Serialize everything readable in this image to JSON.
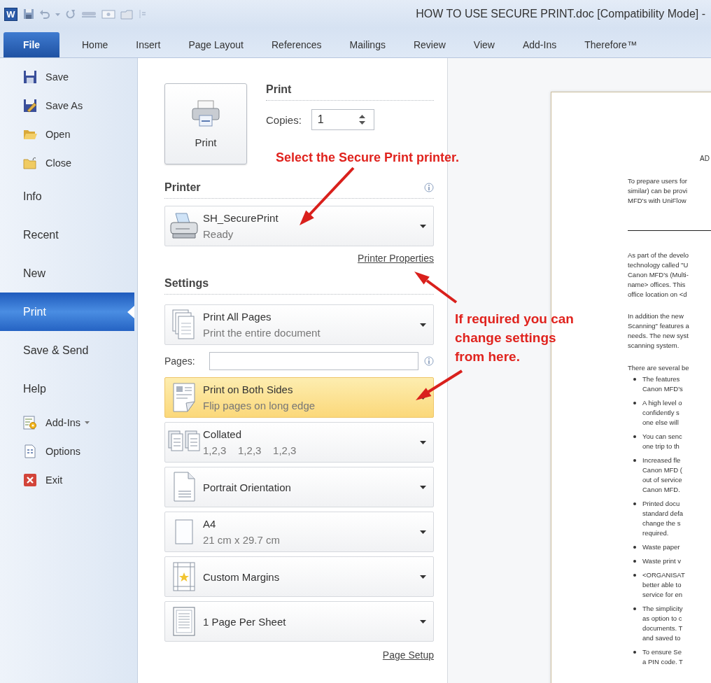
{
  "window": {
    "app_logo": "W",
    "title": "HOW TO USE SECURE PRINT.doc [Compatibility Mode] -"
  },
  "ribbon_tabs": [
    {
      "label": "File",
      "selected": true
    },
    {
      "label": "Home",
      "selected": false
    },
    {
      "label": "Insert",
      "selected": false
    },
    {
      "label": "Page Layout",
      "selected": false
    },
    {
      "label": "References",
      "selected": false
    },
    {
      "label": "Mailings",
      "selected": false
    },
    {
      "label": "Review",
      "selected": false
    },
    {
      "label": "View",
      "selected": false
    },
    {
      "label": "Add-Ins",
      "selected": false
    },
    {
      "label": "Therefore™",
      "selected": false
    }
  ],
  "sidebar": {
    "items": [
      {
        "label": "Save",
        "kind": "command",
        "selected": false,
        "has_menu": false
      },
      {
        "label": "Save As",
        "kind": "command",
        "selected": false,
        "has_menu": false
      },
      {
        "label": "Open",
        "kind": "command",
        "selected": false,
        "has_menu": false
      },
      {
        "label": "Close",
        "kind": "command",
        "selected": false,
        "has_menu": false
      },
      {
        "label": "Info",
        "kind": "view",
        "selected": false,
        "has_menu": false
      },
      {
        "label": "Recent",
        "kind": "view",
        "selected": false,
        "has_menu": false
      },
      {
        "label": "New",
        "kind": "view",
        "selected": false,
        "has_menu": false
      },
      {
        "label": "Print",
        "kind": "view",
        "selected": true,
        "has_menu": false
      },
      {
        "label": "Save & Send",
        "kind": "view",
        "selected": false,
        "has_menu": false
      },
      {
        "label": "Help",
        "kind": "view",
        "selected": false,
        "has_menu": false
      },
      {
        "label": "Add-Ins",
        "kind": "command",
        "selected": false,
        "has_menu": true
      },
      {
        "label": "Options",
        "kind": "command",
        "selected": false,
        "has_menu": false
      },
      {
        "label": "Exit",
        "kind": "command",
        "selected": false,
        "has_menu": false
      }
    ]
  },
  "print": {
    "heading": "Print",
    "button": "Print",
    "copies_label": "Copies:",
    "copies": "1"
  },
  "printer": {
    "heading": "Printer",
    "name": "SH_SecurePrint",
    "status": "Ready",
    "properties_link": "Printer Properties"
  },
  "settings": {
    "heading": "Settings",
    "pages_label": "Pages:",
    "page_setup_link": "Page Setup",
    "options": [
      {
        "title": "Print All Pages",
        "subtitle": "Print the entire document",
        "highlighted": false
      },
      {
        "title": "Print on Both Sides",
        "subtitle": "Flip pages on long edge",
        "highlighted": true
      },
      {
        "title": "Collated",
        "subtitle": "1,2,3    1,2,3    1,2,3",
        "highlighted": false
      },
      {
        "title": "Portrait Orientation",
        "highlighted": false
      },
      {
        "title": "A4",
        "subtitle": "21 cm x 29.7 cm",
        "highlighted": false
      },
      {
        "title": "Custom Margins",
        "highlighted": false
      },
      {
        "title": "1 Page Per Sheet",
        "highlighted": false
      }
    ]
  },
  "annotations": [
    {
      "lines": [
        "Select the Secure Print printer."
      ]
    },
    {
      "lines": [
        "If required you can",
        "change settings",
        "from here."
      ]
    }
  ],
  "document": {
    "heading": "AD",
    "blocks": [
      {
        "kind": "paragraph",
        "lines": [
          "To prepare users for",
          "similar) can be provi",
          "MFD's with UniFlow"
        ]
      },
      {
        "kind": "rule"
      },
      {
        "kind": "paragraph",
        "lines": [
          "As part of the develo",
          "technology called \"U",
          "Canon MFD's (Multi-",
          "name> offices. This",
          "office location on <d"
        ]
      },
      {
        "kind": "paragraph",
        "lines": [
          "In addition the new",
          "Scanning\" features a",
          "needs. The new syst",
          "scanning system."
        ]
      },
      {
        "kind": "paragraph",
        "lines": [
          "There are several be"
        ]
      },
      {
        "kind": "bullets",
        "items": [
          {
            "lines": [
              "The features",
              "Canon MFD's"
            ]
          },
          {
            "lines": [
              "A high level o",
              "confidently s",
              "one else will"
            ]
          },
          {
            "lines": [
              "You can senc",
              "one trip to th"
            ]
          },
          {
            "lines": [
              "Increased fle",
              "Canon MFD (",
              "out of service",
              "Canon MFD."
            ]
          },
          {
            "lines": [
              "Printed docu",
              "standard defa",
              "change the s",
              "required."
            ]
          },
          {
            "lines": [
              "Waste paper"
            ]
          },
          {
            "lines": [
              "Waste print v"
            ]
          },
          {
            "lines": [
              "<ORGANISAT",
              "better able to",
              "service for en"
            ]
          },
          {
            "lines": [
              "The simplicity",
              "as option to c",
              "documents. T",
              "and saved to"
            ]
          },
          {
            "lines": [
              "To ensure Se",
              "a PIN code. T"
            ]
          }
        ]
      }
    ]
  }
}
